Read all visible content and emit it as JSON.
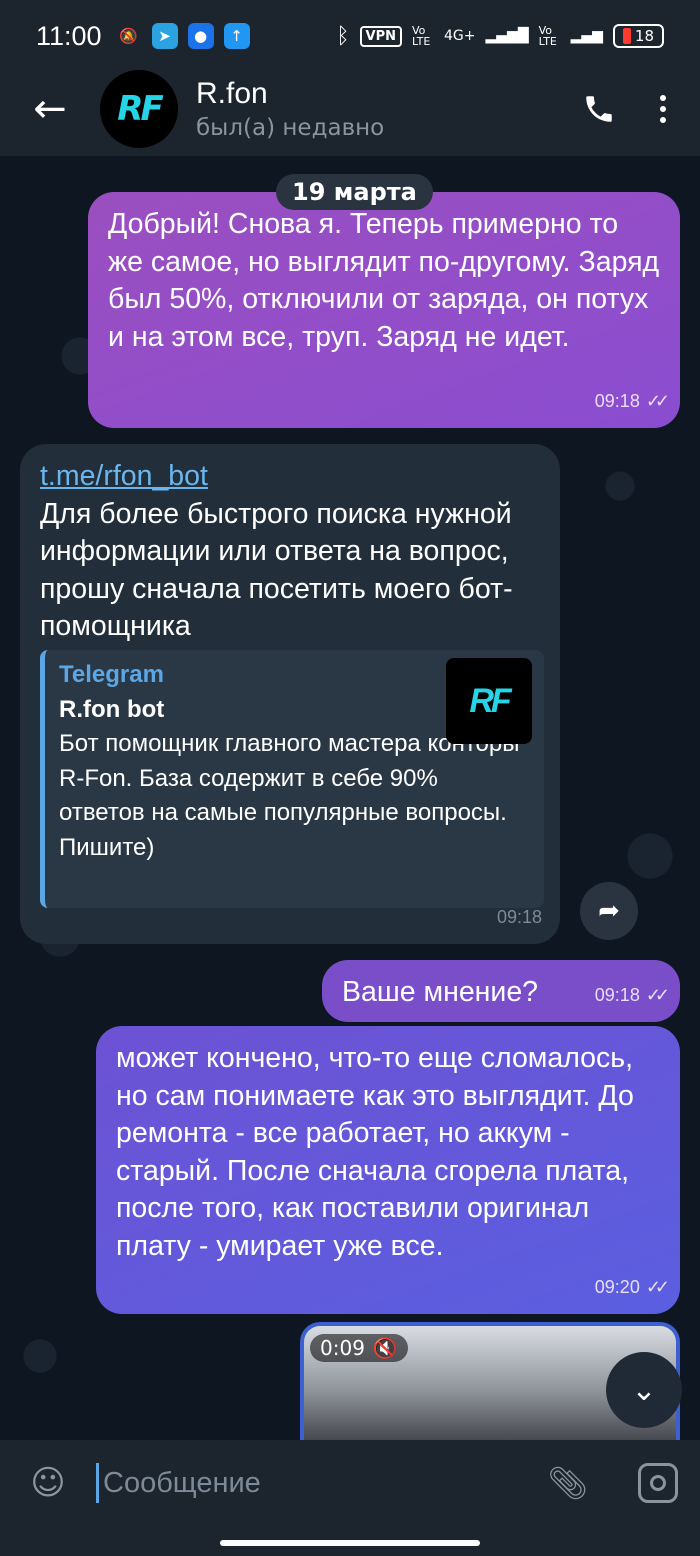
{
  "status_bar": {
    "time": "11:00",
    "vpn": "VPN",
    "net1": "Vo LTE",
    "net2": "4G+",
    "net3": "Vo LTE",
    "battery": "18"
  },
  "header": {
    "contact_name": "R.fon",
    "contact_status": "был(а) недавно",
    "avatar_text": "RF"
  },
  "chat": {
    "date": "19 марта",
    "messages": [
      {
        "text": "Добрый! Снова я. Теперь примерно то же самое, но выглядит по-другому. Заряд был 50%, отключили от заряда, он потух и на этом все, труп. Заряд не идет.",
        "time": "09:18"
      },
      {
        "link": "t.me/rfon_bot",
        "text": "Для более быстрого поиска нужной информации или ответа на вопрос, прошу сначала посетить моего бот-помощника",
        "preview": {
          "site": "Telegram",
          "title": "R.fon bot",
          "description": "Бот помощник главного мастера конторы R-Fon. База содержит в себе 90% ответов на самые популярные вопросы. Пишите)",
          "thumb": "RF"
        },
        "time": "09:18"
      },
      {
        "text": "Ваше мнение?",
        "time": "09:18"
      },
      {
        "text": "может кончено, что-то еще сломалось, но сам понимаете как это выглядит. До ремонта - все работает, но аккум - старый. После сначала сгорела плата, после того, как поставили оригинал плату - умирает уже все.",
        "time": "09:20"
      }
    ],
    "video": {
      "duration": "0:09"
    }
  },
  "input": {
    "placeholder": "Сообщение"
  },
  "colors": {
    "accent": "#5ba7e6",
    "outgoing_1": "#9b4fc0",
    "outgoing_2": "#7a4ec9",
    "outgoing_3": "#6d52d4",
    "incoming": "#222e3a"
  }
}
